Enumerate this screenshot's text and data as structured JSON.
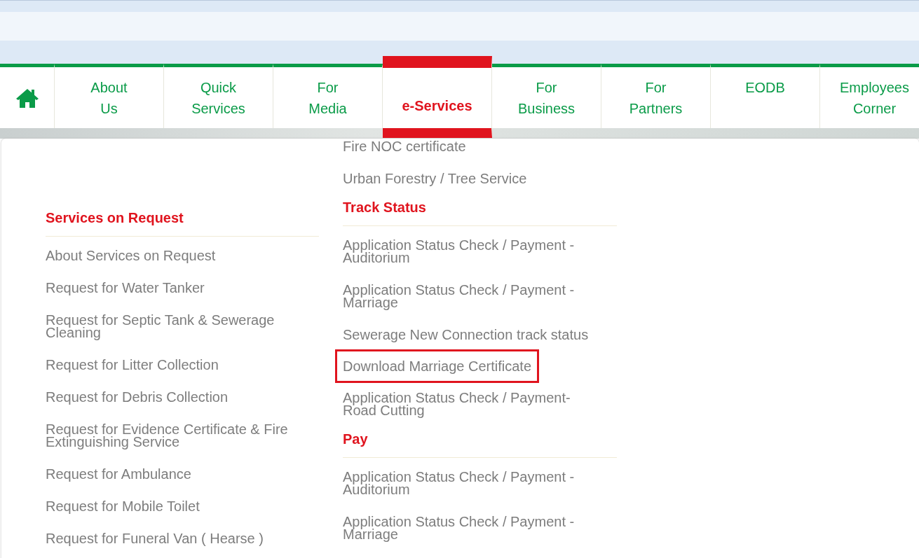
{
  "nav": [
    {
      "kind": "home",
      "selected": false
    },
    {
      "kind": "text",
      "lines": [
        "About",
        "Us"
      ],
      "selected": false
    },
    {
      "kind": "text",
      "lines": [
        "Quick",
        "Services"
      ],
      "selected": false
    },
    {
      "kind": "text",
      "lines": [
        "For",
        "Media"
      ],
      "selected": false
    },
    {
      "kind": "text",
      "lines": [
        "e-Services"
      ],
      "selected": true
    },
    {
      "kind": "text",
      "lines": [
        "For",
        "Business"
      ],
      "selected": false
    },
    {
      "kind": "text",
      "lines": [
        "For",
        "Partners"
      ],
      "selected": false
    },
    {
      "kind": "text",
      "lines": [
        "EODB"
      ],
      "selected": false
    },
    {
      "kind": "text",
      "lines": [
        "Employees",
        "Corner"
      ],
      "selected": false
    }
  ],
  "menu": {
    "columns": [
      {
        "sections": [
          {
            "heading": "Services on Request",
            "items": [
              {
                "label": "About Services on Request",
                "highlighted": false
              },
              {
                "label": "Request for Water Tanker",
                "highlighted": false
              },
              {
                "label": "Request for Septic Tank & Sewerage Cleaning",
                "highlighted": false
              },
              {
                "label": "Request for Litter Collection",
                "highlighted": false
              },
              {
                "label": "Request for Debris Collection",
                "highlighted": false
              },
              {
                "label": "Request for Evidence Certificate & Fire Extinguishing Service",
                "highlighted": false
              },
              {
                "label": "Request for Ambulance",
                "highlighted": false
              },
              {
                "label": "Request for Mobile Toilet",
                "highlighted": false
              },
              {
                "label": "Request for Funeral Van ( Hearse )",
                "highlighted": false
              }
            ]
          }
        ]
      },
      {
        "items": [
          {
            "label": "Fire NOC certificate",
            "highlighted": false
          },
          {
            "label": "Urban Forestry / Tree Service",
            "highlighted": false
          }
        ],
        "sections": [
          {
            "heading": "Track Status",
            "items": [
              {
                "label": "Application Status Check / Payment - Auditorium",
                "highlighted": false
              },
              {
                "label": "Application Status Check / Payment - Marriage",
                "highlighted": false
              },
              {
                "label": "Sewerage New Connection track status",
                "highlighted": false
              },
              {
                "label": "Download Marriage Certificate",
                "highlighted": true
              },
              {
                "label": "Application Status Check / Payment- Road Cutting",
                "highlighted": false
              }
            ]
          },
          {
            "heading": "Pay",
            "items": [
              {
                "label": "Application Status Check / Payment - Auditorium",
                "highlighted": false
              },
              {
                "label": "Application Status Check / Payment - Marriage",
                "highlighted": false
              }
            ]
          }
        ]
      }
    ]
  }
}
